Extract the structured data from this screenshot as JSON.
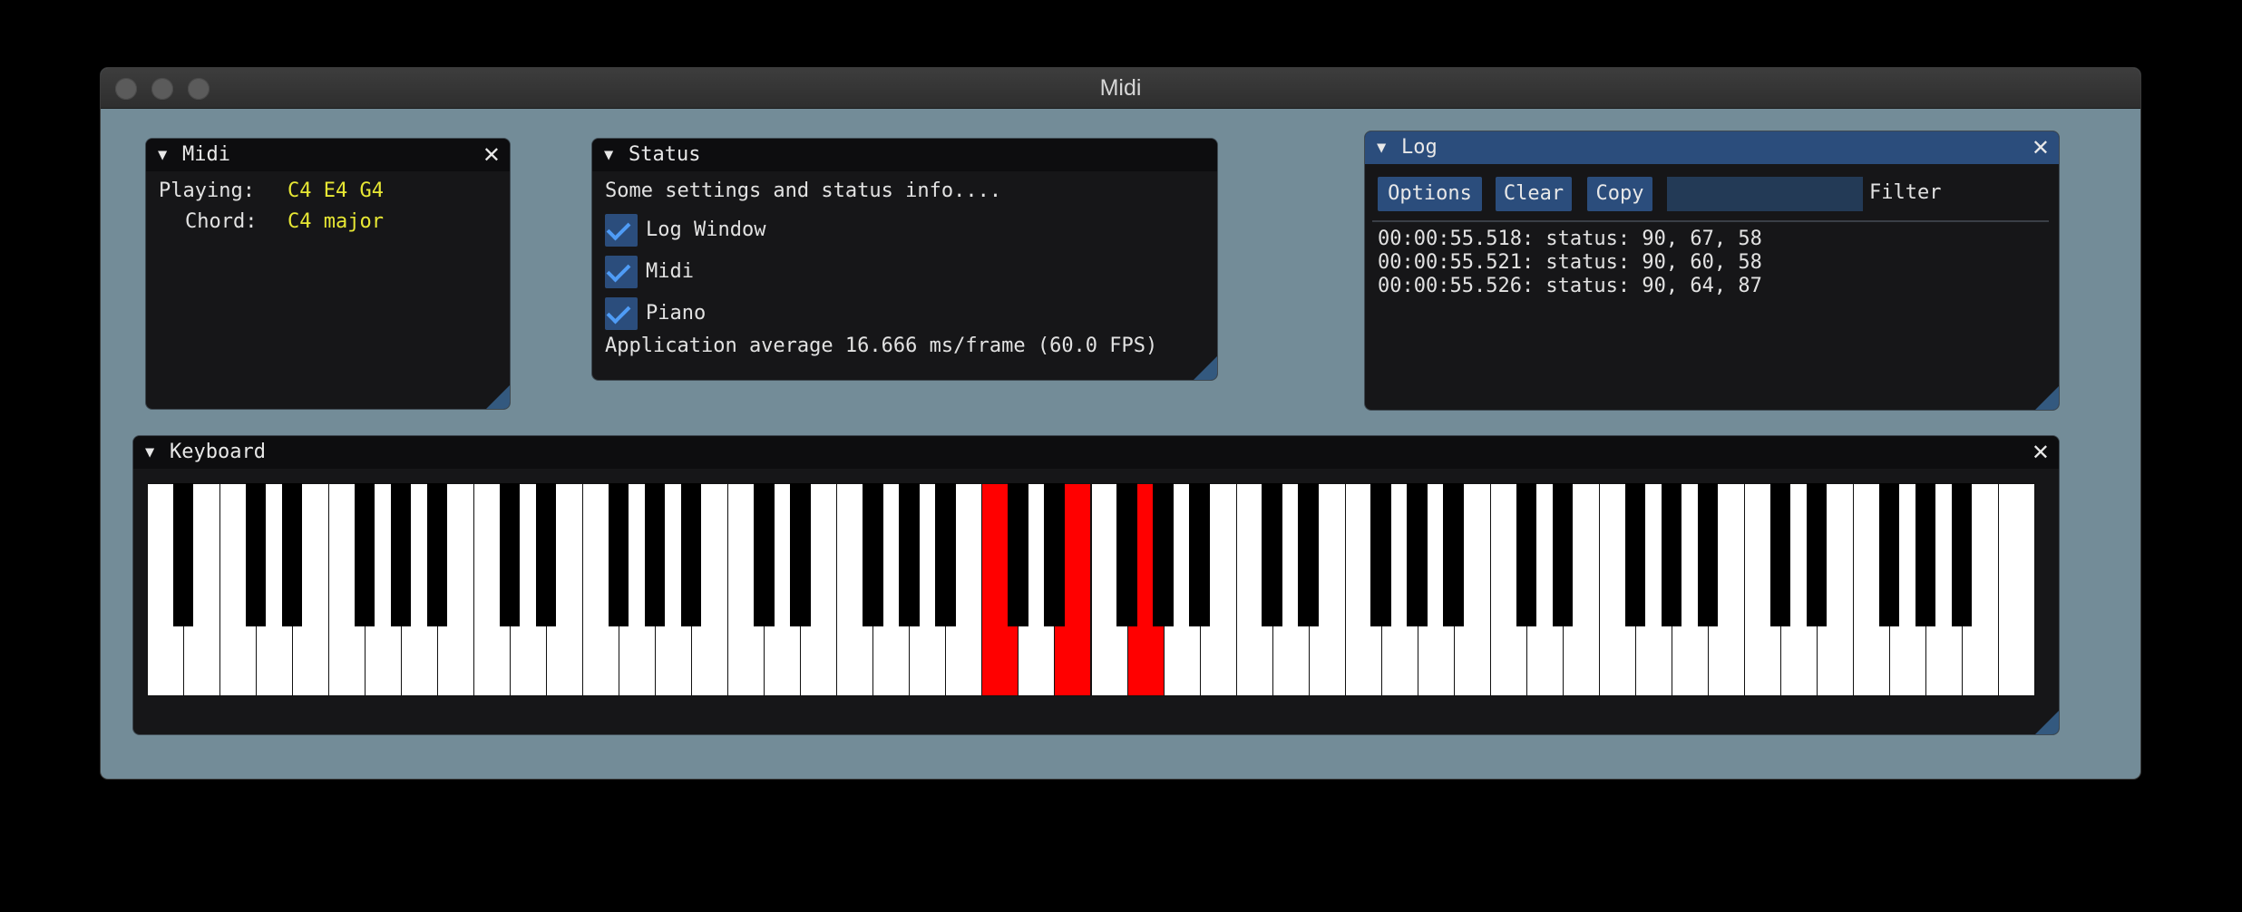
{
  "window": {
    "title": "Midi"
  },
  "midi_panel": {
    "title": "Midi",
    "playing_label": "Playing:",
    "playing_value": "C4 E4 G4",
    "chord_label": "Chord:",
    "chord_value": "C4 major"
  },
  "status_panel": {
    "title": "Status",
    "description": "Some settings and status info....",
    "checkboxes": [
      {
        "label": "Log Window",
        "checked": true
      },
      {
        "label": "Midi",
        "checked": true
      },
      {
        "label": "Piano",
        "checked": true
      }
    ],
    "perf": "Application average 16.666 ms/frame (60.0 FPS)"
  },
  "log_panel": {
    "title": "Log",
    "buttons": {
      "options": "Options",
      "clear": "Clear",
      "copy": "Copy"
    },
    "filter_label": "Filter",
    "filter_value": "",
    "entries": [
      "00:00:55.518: status: 90, 67, 58",
      "00:00:55.521: status: 90, 60, 58",
      "00:00:55.526: status: 90, 64, 87"
    ]
  },
  "keyboard_panel": {
    "title": "Keyboard",
    "white_key_count": 52,
    "lowest_note": "A0",
    "active_notes": [
      "C4",
      "E4",
      "G4"
    ],
    "pressed_color": "#ff0000"
  },
  "theme": {
    "background": "#738c98",
    "panel_bg": "#161618",
    "accent": "#2b4d7c",
    "check_color": "#4f9cf6",
    "highlight_text": "#e8e834"
  }
}
